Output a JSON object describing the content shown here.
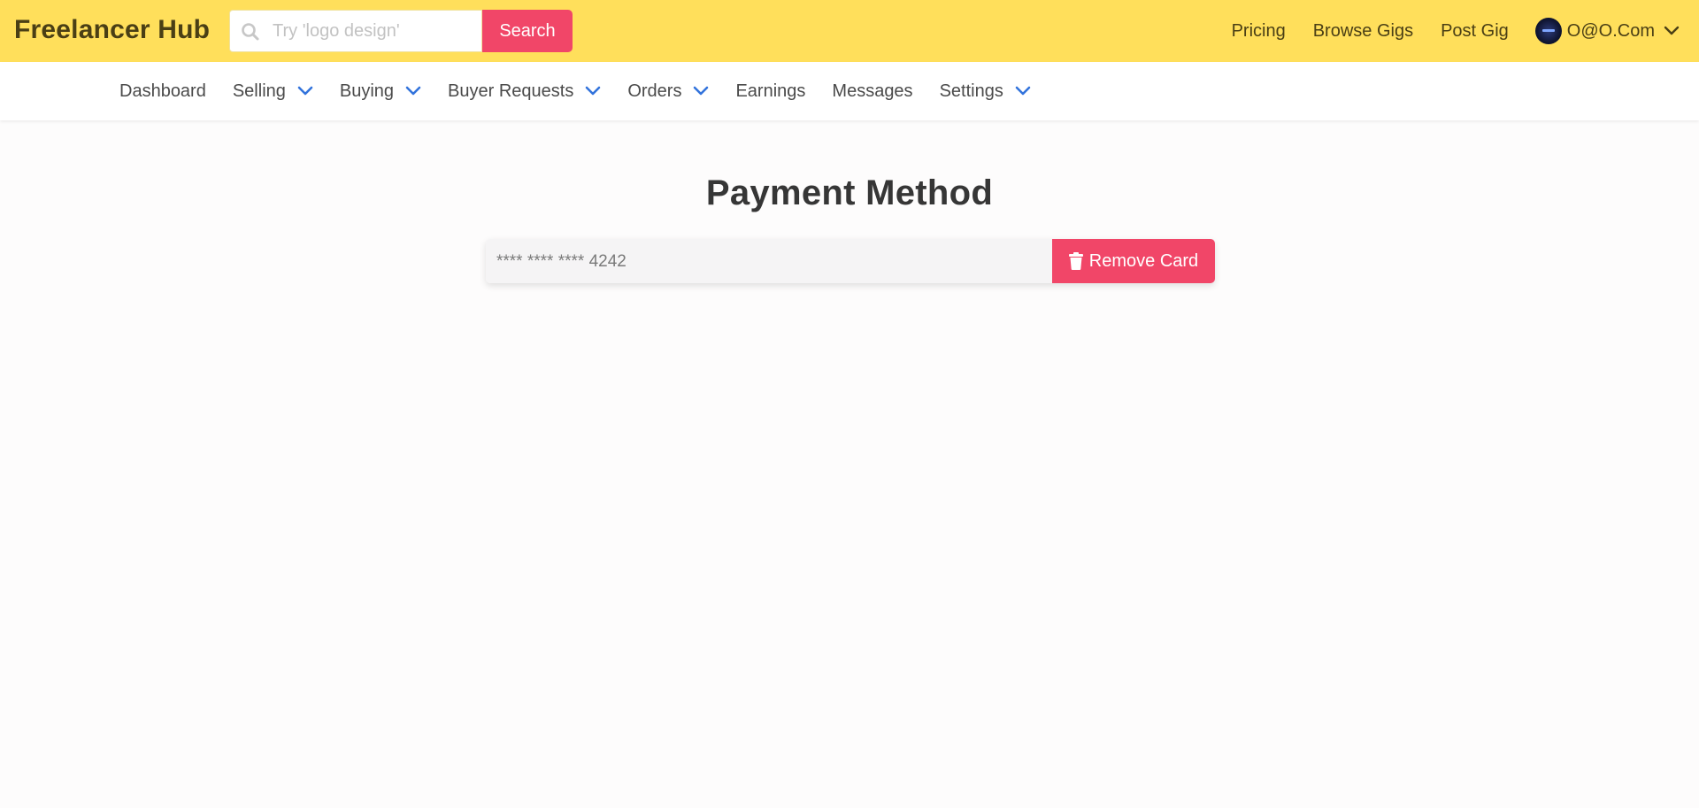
{
  "header": {
    "brand": "Freelancer Hub",
    "search": {
      "placeholder": "Try 'logo design'",
      "value": "",
      "button_label": "Search"
    },
    "links": [
      "Pricing",
      "Browse Gigs",
      "Post Gig"
    ],
    "user": {
      "name": "O@O.Com"
    }
  },
  "subnav": {
    "items": [
      {
        "label": "Dashboard",
        "dropdown": false
      },
      {
        "label": "Selling",
        "dropdown": true
      },
      {
        "label": "Buying",
        "dropdown": true
      },
      {
        "label": "Buyer Requests",
        "dropdown": true
      },
      {
        "label": "Orders",
        "dropdown": true
      },
      {
        "label": "Earnings",
        "dropdown": false
      },
      {
        "label": "Messages",
        "dropdown": false
      },
      {
        "label": "Settings",
        "dropdown": true
      }
    ]
  },
  "main": {
    "title": "Payment Method",
    "card": {
      "masked_number": "**** **** **** 4242",
      "remove_label": "Remove Card"
    }
  },
  "colors": {
    "topbar": "#ffdf5b",
    "accent": "#f14668",
    "chevron": "#3273dc",
    "brand_text": "#4a3f15"
  },
  "icons": [
    "search-icon",
    "chevron-down-icon",
    "trash-icon",
    "avatar"
  ]
}
